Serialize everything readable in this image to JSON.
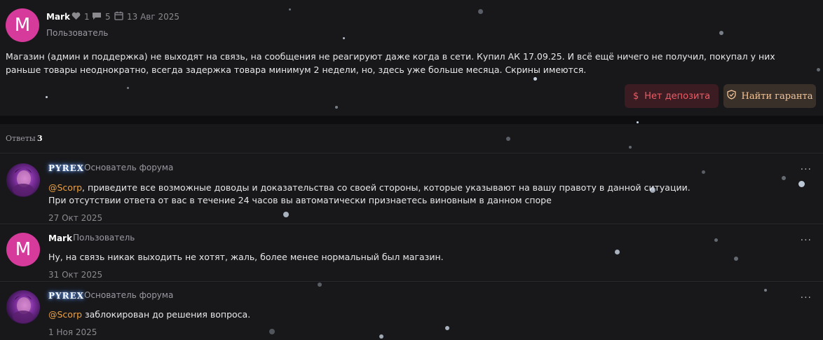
{
  "post": {
    "author": "Mark",
    "avatar_letter": "M",
    "likes": "1",
    "replies": "5",
    "date": "13 Авг 2025",
    "role": "Пользователь",
    "body": "Магазин (админ и поддержка) не выходят на связь, на сообщения не реагируют даже когда в сети. Купил АК 17.09.25. И всё ещё ничего не получил, покупал у них раньше товары неоднократно, всегда задержка товара минимум 2 недели, но, здесь уже больше месяца. Скрины имеются.",
    "buttons": {
      "no_deposit": "Нет депозита",
      "find_guarantor": "Найти гаранта"
    }
  },
  "answers": {
    "label": "Ответы",
    "count": "3"
  },
  "replies": [
    {
      "author": "PYREX",
      "role": "Основатель форума",
      "mention": "@Scorp",
      "text_line1": ", приведите все возможные доводы и доказательства со своей стороны, которые указывают на вашу правоту в данной ситуации.",
      "text_line2": "При отсутствии ответа от вас в течение 24 часов вы автоматически признаетесь виновным в данном споре",
      "date": "27 Окт 2025"
    },
    {
      "author": "Mark",
      "avatar_letter": "M",
      "role": "Пользователь",
      "text_line1": "Ну, на связь никак выходить не хотят, жаль, более менее нормальный был магазин.",
      "date": "31 Окт 2025"
    },
    {
      "author": "PYREX",
      "role": "Основатель форума",
      "mention": "@Scorp",
      "text_line1": " заблокирован до решения вопроса.",
      "date": "1 Ноя 2025"
    }
  ],
  "more_label": "···",
  "colors": {
    "accent_deposit": "#ef5a64",
    "accent_guarantor": "#f2c59a",
    "mention": "#f0a03c",
    "avatar_m": "#d63a9a"
  }
}
